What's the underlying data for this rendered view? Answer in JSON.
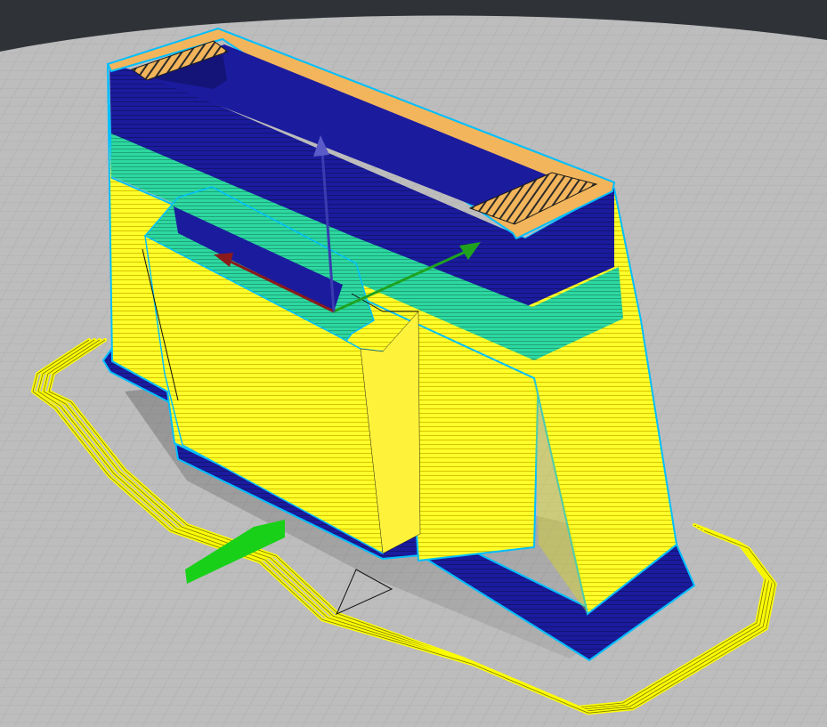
{
  "app": {
    "view": "gcode-preview",
    "description_free": true
  },
  "viewport": {
    "background_color": "#2f3236",
    "bed_color": "#bfbfbf",
    "bed_grid_color": "#a9a9a9",
    "bed_grid_major_color": "#9a9a9a"
  },
  "legend_colors": {
    "skirt": "#ffff00",
    "perimeter": "#ffff22",
    "external_perimeter": "#00bfff",
    "first_layer": "#1a1a9a",
    "top_solid": "#1a1aa0",
    "support_band": "#2fd6a0",
    "solid_infill": "#f4b35a",
    "travel": "#111111"
  },
  "gizmo": {
    "x_axis_color": "#8b1a1a",
    "y_axis_color": "#1fa31f",
    "z_axis_color": "#3b3bb0",
    "origin_marker_color": "#19d019"
  },
  "toolpaths": {
    "skirt_loops": 4
  }
}
